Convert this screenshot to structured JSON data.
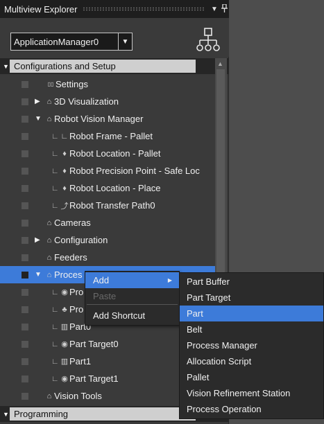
{
  "window": {
    "title": "Multiview Explorer",
    "pin_icon": "pin-icon",
    "menu_icon": "dropdown-arrow-icon"
  },
  "toolbar": {
    "app_select": "ApplicationManager0",
    "hierarchy_icon": "hierarchy-icon"
  },
  "sections": {
    "configurations": "Configurations and Setup",
    "programming": "Programming"
  },
  "tree": [
    {
      "label": "Settings",
      "icon": "settings-icon",
      "expand": ""
    },
    {
      "label": "3D Visualization",
      "icon": "folder-icon",
      "expand": "▶"
    },
    {
      "label": "Robot Vision Manager",
      "icon": "folder-icon",
      "expand": "▼"
    },
    {
      "label": "Robot Frame - Pallet",
      "icon": "frame-icon",
      "expand": ""
    },
    {
      "label": "Robot Location - Pallet",
      "icon": "location-icon",
      "expand": ""
    },
    {
      "label": "Robot Precision Point - Safe Loc",
      "icon": "location-icon",
      "expand": ""
    },
    {
      "label": "Robot Location - Place",
      "icon": "location-icon",
      "expand": ""
    },
    {
      "label": "Robot Transfer Path0",
      "icon": "path-icon",
      "expand": ""
    },
    {
      "label": "Cameras",
      "icon": "folder-icon",
      "expand": ""
    },
    {
      "label": "Configuration",
      "icon": "folder-icon",
      "expand": "▶"
    },
    {
      "label": "Feeders",
      "icon": "folder-icon",
      "expand": ""
    },
    {
      "label": "Proces",
      "icon": "folder-icon",
      "expand": "▼"
    },
    {
      "label": "Pro",
      "icon": "target-icon",
      "expand": ""
    },
    {
      "label": "Pro",
      "icon": "process-icon",
      "expand": ""
    },
    {
      "label": "Part0",
      "icon": "part-icon",
      "expand": ""
    },
    {
      "label": "Part Target0",
      "icon": "target-icon",
      "expand": ""
    },
    {
      "label": "Part1",
      "icon": "part-icon",
      "expand": ""
    },
    {
      "label": "Part Target1",
      "icon": "target-icon",
      "expand": ""
    },
    {
      "label": "Vision Tools",
      "icon": "folder-icon",
      "expand": ""
    }
  ],
  "context_menu": {
    "add": "Add",
    "paste": "Paste",
    "add_shortcut": "Add Shortcut"
  },
  "submenu": [
    "Part Buffer",
    "Part Target",
    "Part",
    "Belt",
    "Process Manager",
    "Allocation Script",
    "Pallet",
    "Vision Refinement Station",
    "Process Operation"
  ],
  "submenu_active_index": 2,
  "colors": {
    "selection": "#3d7bd9",
    "panel": "#3a3a3a",
    "titlebar": "#1e1e1e"
  }
}
